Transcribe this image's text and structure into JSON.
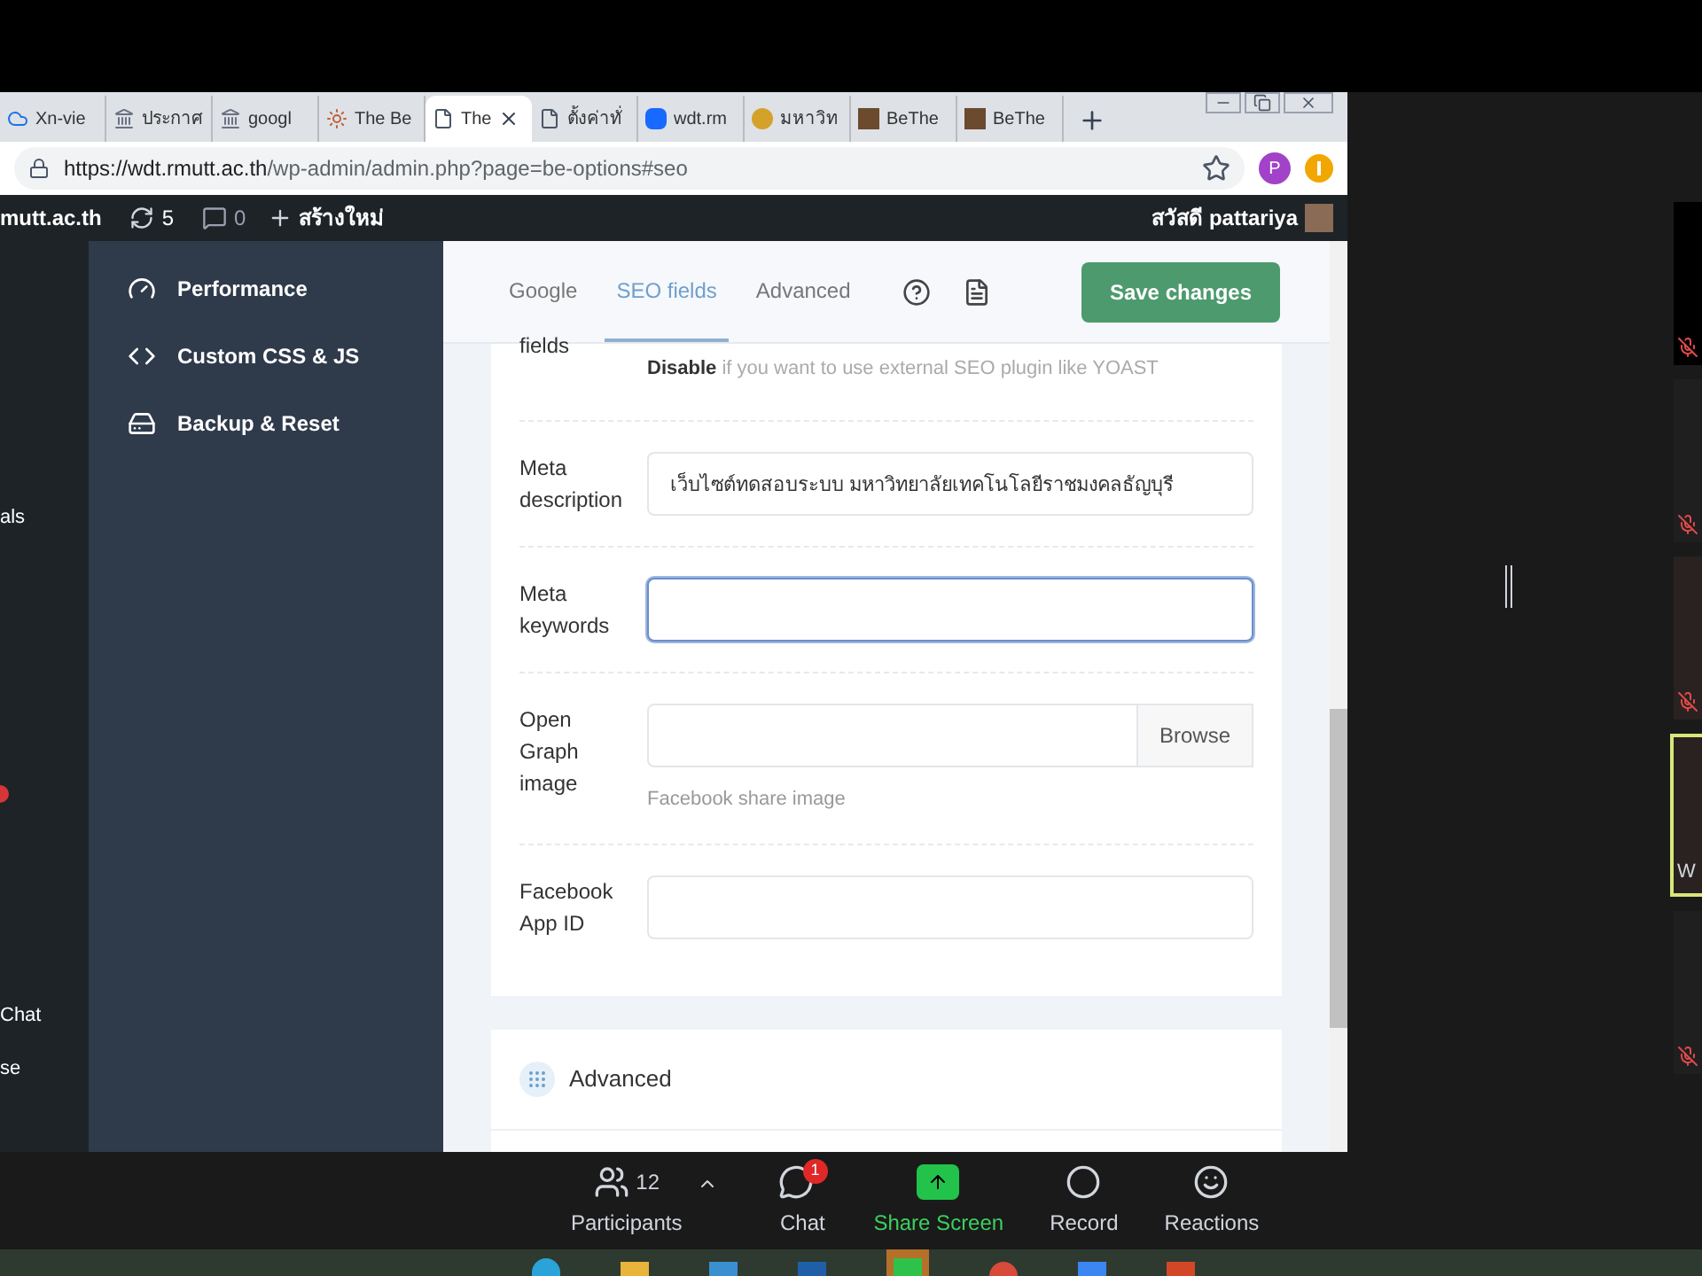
{
  "browser": {
    "tabs": [
      {
        "label": "Xn-vie",
        "kind": "cloud",
        "selected": false
      },
      {
        "label": "ประกาศ",
        "kind": "temple",
        "selected": false
      },
      {
        "label": "googl",
        "kind": "temple",
        "selected": false
      },
      {
        "label": "The Be",
        "kind": "badge",
        "selected": false
      },
      {
        "label": "The",
        "kind": "page",
        "selected": true
      },
      {
        "label": "ตั้งค่าทั่",
        "kind": "page",
        "selected": false
      },
      {
        "label": "wdt.rm",
        "kind": "brand",
        "selected": false
      },
      {
        "label": "มหาวิท",
        "kind": "emblem",
        "selected": false
      },
      {
        "label": "BeThe",
        "kind": "photo",
        "selected": false
      },
      {
        "label": "BeThe",
        "kind": "photo",
        "selected": false
      }
    ],
    "url_host": "https://wdt.rmutt.ac.th",
    "url_path": "/wp-admin/admin.php?page=be-options#seo",
    "profile_initial": "P"
  },
  "admin_bar": {
    "site": "mutt.ac.th",
    "updates": "5",
    "comments": "0",
    "new": "สร้างใหม่",
    "greeting": "สวัสดี pattariya"
  },
  "left_menu": [
    {
      "label": "als"
    },
    {
      "label": "Chat"
    },
    {
      "label": "se"
    }
  ],
  "sidebar": {
    "items": [
      {
        "label": "Performance",
        "kind": "gauge"
      },
      {
        "label": "Custom CSS & JS",
        "kind": "code"
      },
      {
        "label": "Backup & Reset",
        "kind": "drive"
      }
    ]
  },
  "tabs": [
    {
      "label": "Google",
      "selected": false
    },
    {
      "label": "SEO fields",
      "selected": true
    },
    {
      "label": "Advanced",
      "selected": false
    }
  ],
  "save_button": "Save changes",
  "seo_card": {
    "cut_label": "fields",
    "note": "**Disable** if you want to use external SEO plugin like YOAST",
    "fields": [
      {
        "kind": "text",
        "label": "Meta description",
        "value": "เว็บไซต์ทดสอบระบบ มหาวิทยาลัยเทคโนโลยีราชมงคลธัญบุรี",
        "focused": false
      },
      {
        "kind": "text",
        "label": "Meta keywords",
        "focused": true
      },
      {
        "kind": "file",
        "label": "Open Graph image",
        "button": "Browse",
        "hint": "Facebook share image",
        "focused": false
      },
      {
        "kind": "text",
        "label": "Facebook App ID",
        "focused": false
      }
    ]
  },
  "advanced_card": {
    "title": "Advanced"
  },
  "zoom_toolbar": {
    "participants": "Participants",
    "participant_count": "12",
    "chat": "Chat",
    "chat_badge": "1",
    "share": "Share Screen",
    "record": "Record",
    "reactions": "Reactions"
  },
  "gallery": {
    "tiles": [
      {
        "kind": "dark",
        "muted": true,
        "active": false
      },
      {
        "kind": "blank",
        "muted": true,
        "active": false
      },
      {
        "kind": "video",
        "muted": true,
        "active": false
      },
      {
        "kind": "video",
        "muted": false,
        "active": true,
        "name": "W"
      },
      {
        "kind": "blank",
        "muted": true,
        "active": false
      }
    ]
  }
}
